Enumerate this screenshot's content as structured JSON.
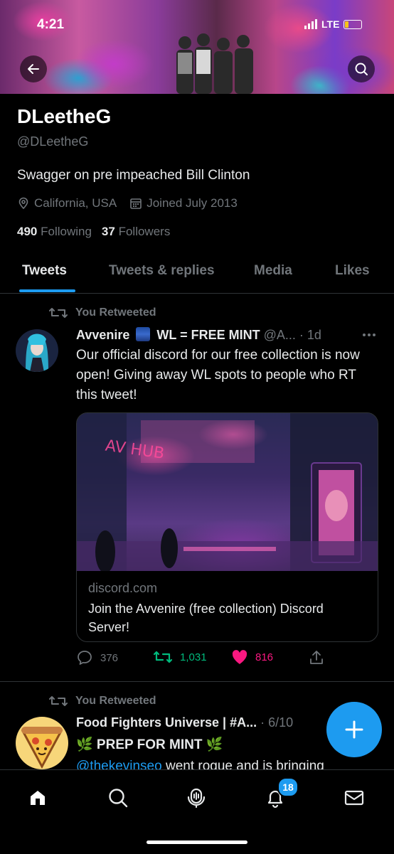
{
  "status_bar": {
    "time": "4:21",
    "network": "LTE"
  },
  "profile": {
    "name": "DLeetheG",
    "handle": "@DLeetheG",
    "bio": "Swagger on pre impeached Bill Clinton",
    "location": "California, USA",
    "joined": "Joined July 2013",
    "following_count": "490",
    "following_label": "Following",
    "followers_count": "37",
    "followers_label": "Followers"
  },
  "tabs": [
    {
      "label": "Tweets",
      "active": true
    },
    {
      "label": "Tweets & replies",
      "active": false
    },
    {
      "label": "Media",
      "active": false
    },
    {
      "label": "Likes",
      "active": false
    }
  ],
  "tweets": [
    {
      "retweet_label": "You Retweeted",
      "author": "Avvenire",
      "author_suffix": "WL = FREE MINT",
      "handle": "@A...",
      "time": "· 1d",
      "text": "Our official discord for our free collection is now open! Giving away WL spots to people who RT this tweet!",
      "card": {
        "domain": "discord.com",
        "title": "Join the Avvenire (free collection) Discord Server!",
        "image_sign": "AV HUB"
      },
      "replies": "376",
      "retweets": "1,031",
      "likes": "816"
    },
    {
      "retweet_label": "You Retweeted",
      "author": "Food Fighters Universe | #A...",
      "time": "· 6/10",
      "line1": "🌿 PREP FOR MINT 🌿",
      "line2_link": "@thekevinseo",
      "line2_rest": " went rogue and is bringing"
    }
  ],
  "notifications_badge": "18",
  "icons": {
    "back": "back-arrow-icon",
    "search": "search-icon",
    "location": "location-pin-icon",
    "calendar": "calendar-icon",
    "retweet": "retweet-icon",
    "more": "more-dots-icon",
    "reply": "reply-icon",
    "like": "heart-icon",
    "share": "share-icon",
    "compose": "plus-icon",
    "home": "home-icon",
    "explore": "search-icon",
    "spaces": "spaces-icon",
    "notifications": "bell-icon",
    "messages": "mail-icon"
  },
  "colors": {
    "accent": "#1d9bf0",
    "retweet": "#00ba7c",
    "like": "#f91880",
    "muted": "#71767b"
  }
}
